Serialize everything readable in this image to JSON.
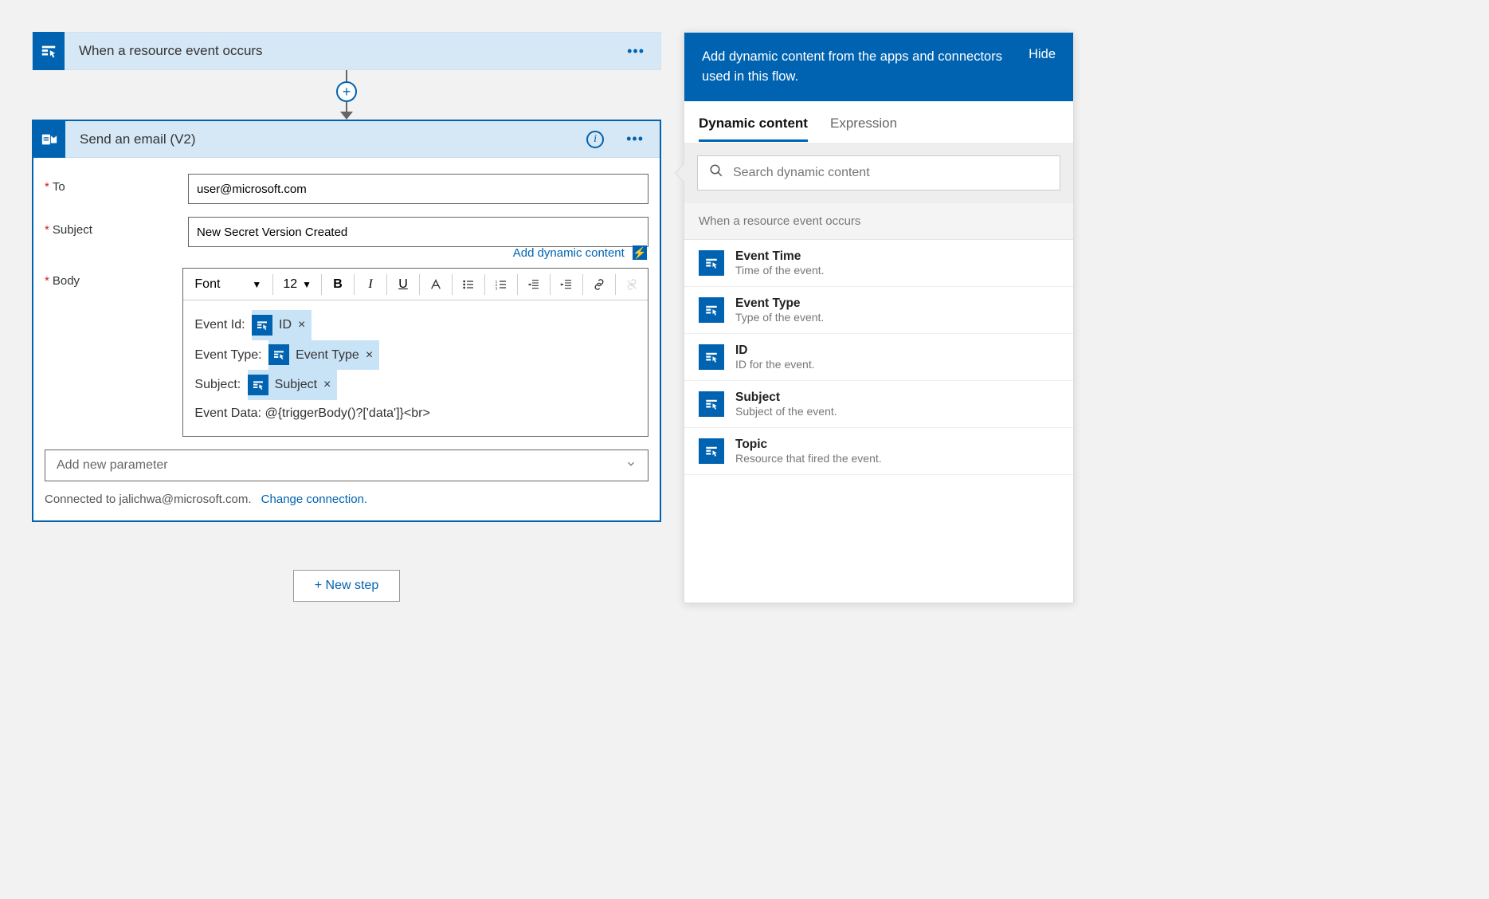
{
  "trigger": {
    "title": "When a resource event occurs"
  },
  "action": {
    "title": "Send an email (V2)",
    "fields": {
      "to_label": "To",
      "to_value": "user@microsoft.com",
      "subject_label": "Subject",
      "subject_value": "New Secret Version Created",
      "body_label": "Body"
    },
    "hint_link": "Add dynamic content",
    "rte": {
      "font": "Font",
      "size": "12",
      "body_lines": {
        "l1_label": "Event Id:",
        "l1_token": "ID",
        "l2_label": "Event Type:",
        "l2_token": "Event Type",
        "l3_label": "Subject:",
        "l3_token": "Subject",
        "l4": "Event Data: @{triggerBody()?['data']}<br>"
      }
    },
    "param_placeholder": "Add new parameter",
    "connected_text": "Connected to jalichwa@microsoft.com.",
    "change_conn": "Change connection."
  },
  "new_step": "+ New step",
  "panel": {
    "head": "Add dynamic content from the apps and connectors used in this flow.",
    "hide": "Hide",
    "tab_dynamic": "Dynamic content",
    "tab_expr": "Expression",
    "search_placeholder": "Search dynamic content",
    "group": "When a resource event occurs",
    "items": [
      {
        "title": "Event Time",
        "desc": "Time of the event."
      },
      {
        "title": "Event Type",
        "desc": "Type of the event."
      },
      {
        "title": "ID",
        "desc": "ID for the event."
      },
      {
        "title": "Subject",
        "desc": "Subject of the event."
      },
      {
        "title": "Topic",
        "desc": "Resource that fired the event."
      }
    ]
  }
}
